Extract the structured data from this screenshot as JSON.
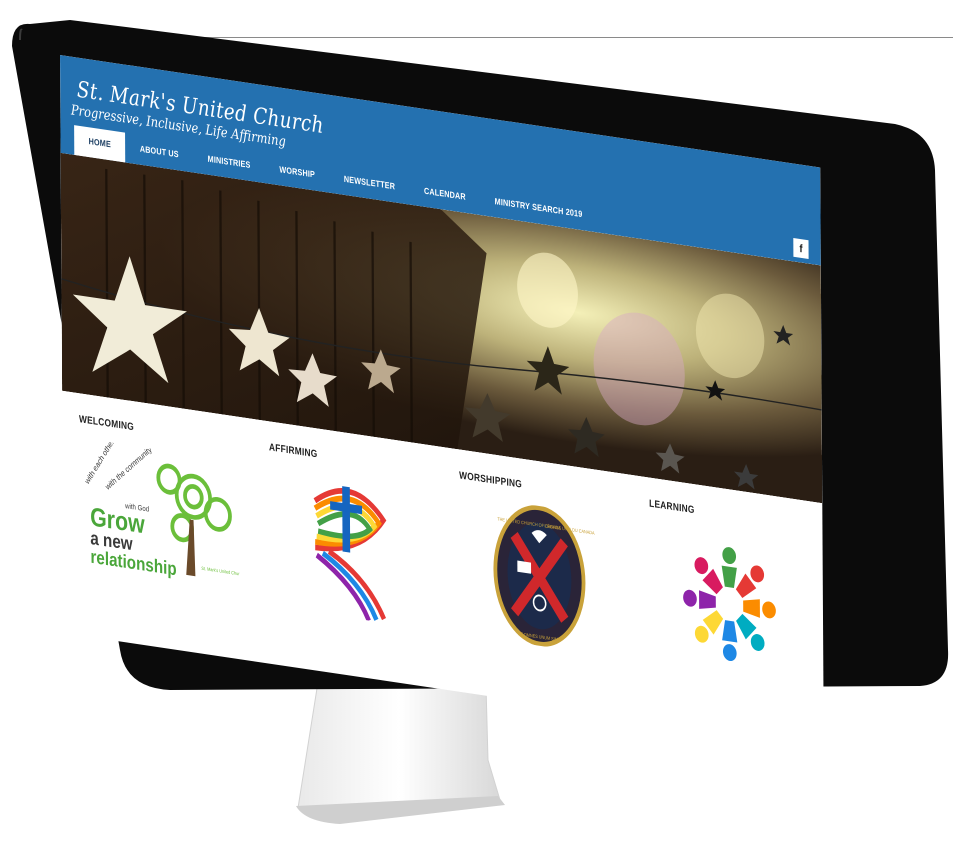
{
  "site": {
    "title": "St. Mark's United Church",
    "tagline": "Progressive, Inclusive, Life Affirming"
  },
  "nav": {
    "items": [
      {
        "label": "HOME",
        "active": true
      },
      {
        "label": "ABOUT US",
        "active": false
      },
      {
        "label": "MINISTRIES",
        "active": false
      },
      {
        "label": "WORSHIP",
        "active": false
      },
      {
        "label": "NEWSLETTER",
        "active": false
      },
      {
        "label": "CALENDAR",
        "active": false
      },
      {
        "label": "MINISTRY SEARCH 2019",
        "active": false
      }
    ],
    "facebook_label": "f"
  },
  "sections": [
    {
      "heading": "WELCOMING",
      "image": "grow-a-new-relationship-logo",
      "logo_text": [
        "with each other",
        "with the community",
        "with God",
        "Grow",
        "a new",
        "relationship",
        "St. Mark's United Church"
      ]
    },
    {
      "heading": "AFFIRMING",
      "image": "rainbow-cross-logo"
    },
    {
      "heading": "WORSHIPPING",
      "image": "united-church-crest",
      "logo_text": [
        "THE UNITED CHURCH OF CANADA",
        "L'ÉGLISE UNIE DU CANADA",
        "UT OMNES UNUM SINT"
      ]
    },
    {
      "heading": "LEARNING",
      "image": "people-circle-icon"
    }
  ],
  "colors": {
    "header": "#2471b0",
    "nav_active_bg": "#ffffff",
    "bezel": "#0a0a0a"
  }
}
